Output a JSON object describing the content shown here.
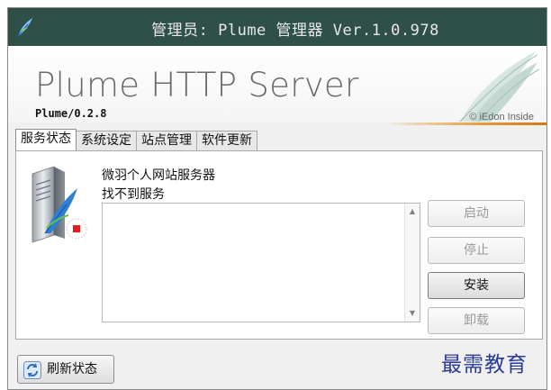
{
  "window": {
    "title": "管理员: Plume 管理器 Ver.1.0.978"
  },
  "banner": {
    "product": "Plume HTTP Server",
    "version": "Plume/0.2.8",
    "credit": "© iEdon Inside"
  },
  "tabs": [
    {
      "label": "服务状态",
      "active": true
    },
    {
      "label": "系统设定",
      "active": false
    },
    {
      "label": "站点管理",
      "active": false
    },
    {
      "label": "软件更新",
      "active": false
    }
  ],
  "service": {
    "name": "微羽个人网站服务器",
    "status": "找不到服务",
    "log": ""
  },
  "buttons": {
    "start": {
      "label": "启动",
      "enabled": false
    },
    "stop": {
      "label": "停止",
      "enabled": false
    },
    "install": {
      "label": "安装",
      "enabled": true
    },
    "uninstall": {
      "label": "卸载",
      "enabled": false
    },
    "refresh": {
      "label": "刷新状态",
      "enabled": true
    }
  },
  "watermark": "最需教育",
  "colors": {
    "titlebar": "#2f4f49",
    "accent": "#e59a3a",
    "status_stopped": "#e31b1b",
    "watermark": "#2a3a9a"
  }
}
